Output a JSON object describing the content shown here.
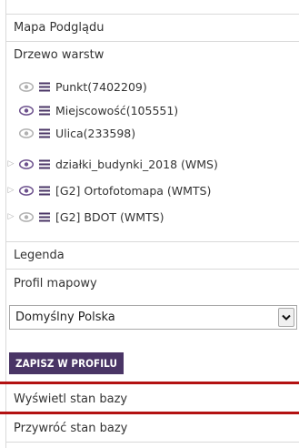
{
  "colors": {
    "eye_active": "#6b4f8c",
    "eye_inactive": "#b0b0b0",
    "menu_icon": "#4a3566",
    "button_bg": "#4a3566",
    "highlight_line": "#b31111"
  },
  "sections": {
    "preview_map": "Mapa Podglądu",
    "layer_tree": "Drzewo warstw",
    "legend": "Legenda",
    "map_profile": "Profil mapowy",
    "show_db_state": "Wyświetl stan bazy",
    "restore_db_state": "Przywróć stan bazy"
  },
  "layers": [
    {
      "label": "Punkt(7402209)",
      "visible": false,
      "expandable": false,
      "eye_icon": "eye-icon",
      "menu_icon": "list-icon"
    },
    {
      "label": "Miejscowość(105551)",
      "visible": true,
      "expandable": false,
      "eye_icon": "eye-icon",
      "menu_icon": "list-icon"
    },
    {
      "label": "Ulica(233598)",
      "visible": false,
      "expandable": false,
      "eye_icon": "eye-icon",
      "menu_icon": "list-icon"
    },
    {
      "label": "działki_budynki_2018 (WMS)",
      "visible": true,
      "expandable": true,
      "eye_icon": "eye-icon",
      "menu_icon": "list-icon"
    },
    {
      "label": "[G2] Ortofotomapa (WMTS)",
      "visible": true,
      "expandable": true,
      "eye_icon": "eye-icon",
      "menu_icon": "list-icon"
    },
    {
      "label": "[G2] BDOT (WMTS)",
      "visible": false,
      "expandable": true,
      "eye_icon": "eye-icon",
      "menu_icon": "list-icon"
    }
  ],
  "profile": {
    "selected": "Domyślny Polska",
    "save_label": "ZAPISZ W PROFILU"
  }
}
